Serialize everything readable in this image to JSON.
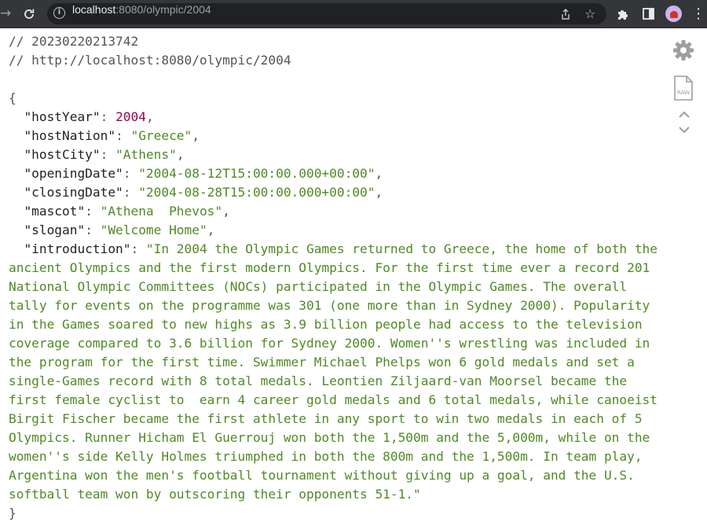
{
  "browser": {
    "url_host": "localhost",
    "url_rest": ":8080/olympic/2004"
  },
  "viewer": {
    "comment_timestamp": "// 20230220213742",
    "comment_url": "// http://localhost:8080/olympic/2004",
    "raw_label": "RAW",
    "colors": {
      "key": "#222222",
      "number": "#a0004f",
      "string": "#4f8a24"
    },
    "json": {
      "hostYear": "2004",
      "hostNation": "\"Greece\"",
      "hostCity": "\"Athens\"",
      "openingDate": "\"2004-08-12T15:00:00.000+00:00\"",
      "closingDate": "\"2004-08-28T15:00:00.000+00:00\"",
      "mascot": "\"Athena  Phevos\"",
      "slogan": "\"Welcome Home\"",
      "introduction": "\"In 2004 the Olympic Games returned to Greece, the home of both the ancient Olympics and the first modern Olympics. For the first time ever a record 201 National Olympic Committees (NOCs) participated in the Olympic Games. The overall tally for events on the programme was 301 (one more than in Sydney 2000). Popularity in the Games soared to new highs as 3.9 billion people had access to the television coverage compared to 3.6 billion for Sydney 2000. Women''s wrestling was included in the program for the first time. Swimmer Michael Phelps won 6 gold medals and set a single-Games record with 8 total medals. Leontien Ziljaard-van Moorsel became the first female cyclist to  earn 4 career gold medals and 6 total medals, while canoeist Birgit Fischer became the first athlete in any sport to win two medals in each of 5 Olympics. Runner Hicham El Guerrouj won both the 1,500m and the 5,000m, while on the women''s side Kelly Holmes triumphed in both the 800m and the 1,500m. In team play, Argentina won the men's football tournament without giving up a goal, and the U.S. softball team won by outscoring their opponents 51-1.\""
    }
  }
}
